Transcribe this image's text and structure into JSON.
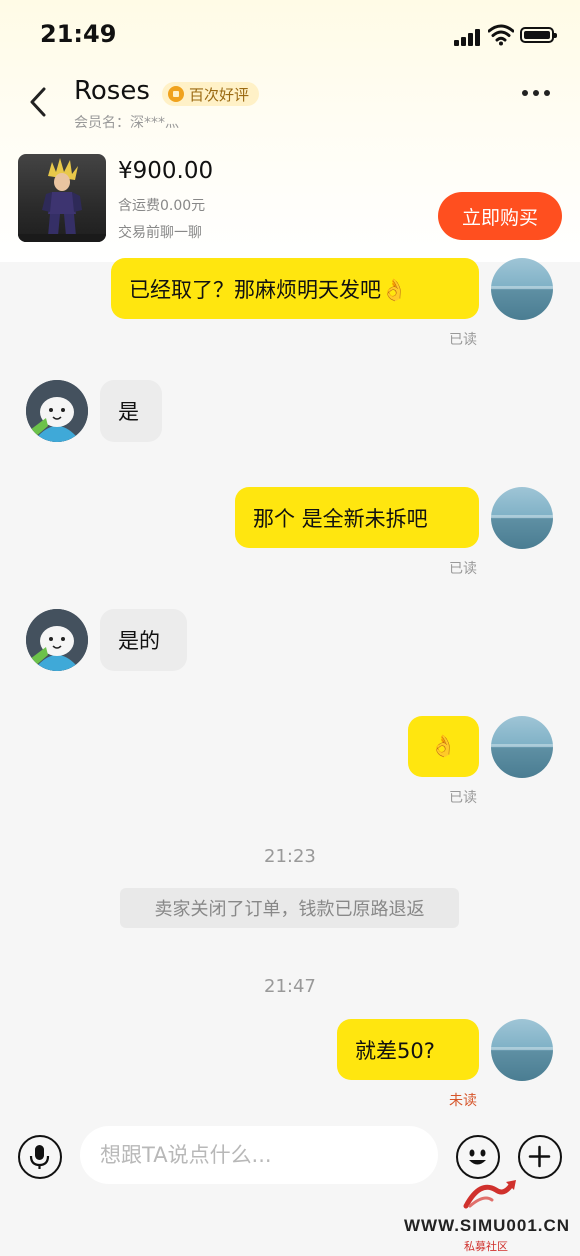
{
  "status_bar": {
    "time": "21:49"
  },
  "header": {
    "title": "Roses",
    "badge": "百次好评",
    "member_label": "会员名：深***灬"
  },
  "product": {
    "price": "¥900.00",
    "shipping": "含运费0.00元",
    "note": "交易前聊一聊",
    "buy_button": "立即购买"
  },
  "messages": [
    {
      "sender": "me",
      "text": "已经取了？那麻烦明天发吧👌",
      "status": "已读"
    },
    {
      "sender": "seller",
      "text": "是"
    },
    {
      "sender": "me",
      "text": "那个 是全新未拆吧",
      "status": "已读"
    },
    {
      "sender": "seller",
      "text": "是的"
    },
    {
      "sender": "me",
      "text": "👌",
      "status": "已读"
    },
    {
      "type": "timestamp",
      "text": "21:23"
    },
    {
      "type": "system",
      "text": "卖家关闭了订单，钱款已原路退返"
    },
    {
      "type": "timestamp",
      "text": "21:47"
    },
    {
      "sender": "me",
      "text": "就差50?",
      "status": "未读"
    }
  ],
  "input": {
    "placeholder": "想跟TA说点什么..."
  },
  "watermark": {
    "url": "WWW.SIMU001.CN",
    "subtitle": "私募社区"
  },
  "colors": {
    "my_bubble": "#ffe60f",
    "their_bubble": "#ececec",
    "buy_button": "#ff4f1f",
    "badge_background": "#fff1c7",
    "unread_status": "#d6552a"
  },
  "icons": {
    "back": "chevron-left-icon",
    "more": "more-dots-icon",
    "microphone": "microphone-icon",
    "emoji": "smiley-icon",
    "plus": "plus-icon"
  }
}
